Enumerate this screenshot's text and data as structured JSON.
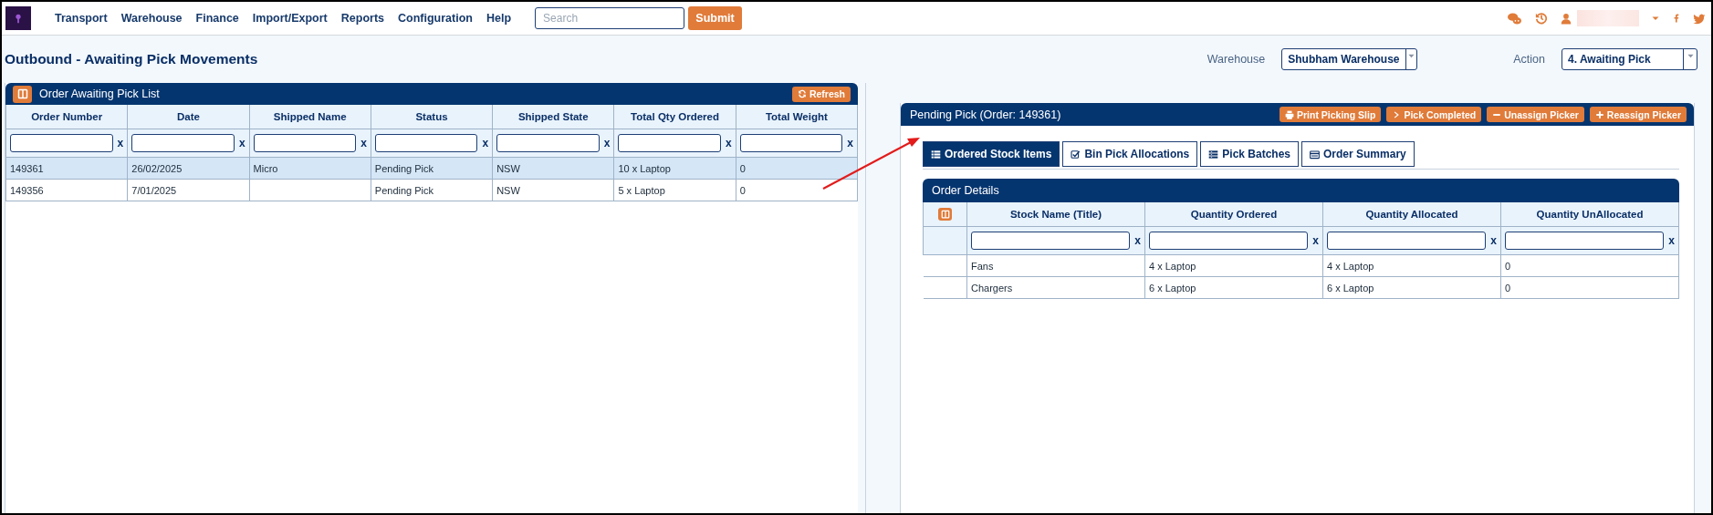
{
  "nav": {
    "items": [
      "Transport",
      "Warehouse",
      "Finance",
      "Import/Export",
      "Reports",
      "Configuration",
      "Help"
    ],
    "search": {
      "placeholder": "Search"
    },
    "submit": "Submit"
  },
  "page": {
    "title": "Outbound - Awaiting Pick Movements",
    "warehouse_label": "Warehouse",
    "warehouse_value": "Shubham Warehouse",
    "action_label": "Action",
    "action_value": "4. Awaiting Pick"
  },
  "left": {
    "title": "Order Awaiting Pick List",
    "refresh": "Refresh",
    "columns": [
      {
        "label": "Order Number",
        "clear": "x"
      },
      {
        "label": "Date",
        "clear": "x"
      },
      {
        "label": "Shipped Name",
        "clear": "x"
      },
      {
        "label": "Status",
        "clear": "x"
      },
      {
        "label": "Shipped State",
        "clear": "x"
      },
      {
        "label": "Total Qty Ordered",
        "clear": "x"
      },
      {
        "label": "Total Weight",
        "clear": "x"
      }
    ],
    "rows": [
      {
        "selected": true,
        "cells": [
          "149361",
          "26/02/2025",
          "Micro",
          "Pending Pick",
          "NSW",
          "10 x Laptop",
          "0"
        ]
      },
      {
        "selected": false,
        "cells": [
          "149356",
          "7/01/2025",
          "",
          "Pending Pick",
          "NSW",
          "5 x Laptop",
          "0"
        ]
      }
    ]
  },
  "right": {
    "title": "Pending Pick (Order: 149361)",
    "buttons": [
      {
        "kind": "print",
        "label": "Print Picking Slip"
      },
      {
        "kind": "chevron",
        "label": "Pick Completed"
      },
      {
        "kind": "minus",
        "label": "Unassign Picker"
      },
      {
        "kind": "plus",
        "label": "Reassign Picker"
      }
    ],
    "tabs": [
      {
        "kind": "list",
        "label": "Ordered Stock Items",
        "selected": true
      },
      {
        "kind": "check",
        "label": "Bin Pick Allocations",
        "selected": false
      },
      {
        "kind": "batches",
        "label": "Pick Batches",
        "selected": false
      },
      {
        "kind": "card",
        "label": "Order Summary",
        "selected": false
      }
    ],
    "details": {
      "title": "Order Details",
      "columns": [
        {
          "label": "Stock Name (Title)",
          "clear": "x"
        },
        {
          "label": "Quantity Ordered",
          "clear": "x"
        },
        {
          "label": "Quantity Allocated",
          "clear": "x"
        },
        {
          "label": "Quantity UnAllocated",
          "clear": "x"
        }
      ],
      "rows": [
        {
          "cells": [
            "Fans",
            "4 x Laptop",
            "4 x Laptop",
            "0"
          ]
        },
        {
          "cells": [
            "Chargers",
            "6 x Laptop",
            "6 x Laptop",
            "0"
          ]
        }
      ]
    }
  }
}
